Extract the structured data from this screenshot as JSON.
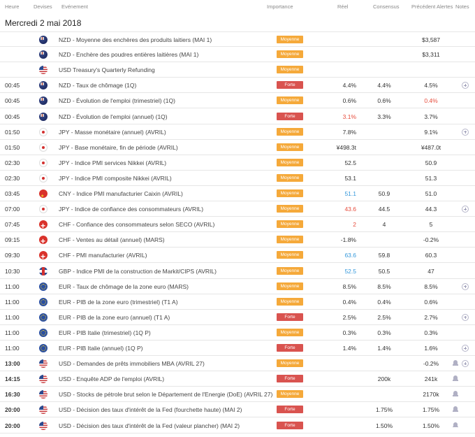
{
  "header": {
    "time": "Heure",
    "currency": "Devises",
    "event": "Evénement",
    "importance": "Importance",
    "actual": "Réel",
    "consensus": "Consensus",
    "previous": "Précédent",
    "alerts": "Alertes",
    "notes": "Notes"
  },
  "date_title": "Mercredi 2 mai 2018",
  "colors": {
    "moyenne": "#f5a93a",
    "forte": "#d9534f",
    "negative_value": "#e74c3c",
    "positive_value": "#3498db"
  },
  "rows": [
    {
      "time": "",
      "bold_time": false,
      "flag": "nz",
      "event": "NZD - Moyenne des enchères des produits laitiers (MAI 1)",
      "importance": "Moyenne",
      "actual": "",
      "actual_color": "",
      "consensus": "",
      "previous": "$3,587",
      "previous_color": "",
      "alert": "",
      "note": ""
    },
    {
      "time": "",
      "bold_time": false,
      "flag": "nz",
      "event": "NZD - Enchère des poudres entières laitières (MAI 1)",
      "importance": "Moyenne",
      "actual": "",
      "actual_color": "",
      "consensus": "",
      "previous": "$3,311",
      "previous_color": "",
      "alert": "",
      "note": ""
    },
    {
      "time": "",
      "bold_time": false,
      "flag": "us",
      "event": "USD Treasury's Quarterly Refunding",
      "importance": "Moyenne",
      "actual": "",
      "actual_color": "",
      "consensus": "",
      "previous": "",
      "previous_color": "",
      "alert": "",
      "note": ""
    },
    {
      "time": "00:45",
      "bold_time": false,
      "flag": "nz",
      "event": "NZD - Taux de chômage (1Q)",
      "importance": "Forte",
      "actual": "4.4%",
      "actual_color": "",
      "consensus": "4.4%",
      "previous": "4.5%",
      "previous_color": "",
      "alert": "",
      "note": "plus-icon"
    },
    {
      "time": "00:45",
      "bold_time": false,
      "flag": "nz",
      "event": "NZD - Évolution de l'emploi (trimestriel) (1Q)",
      "importance": "Moyenne",
      "actual": "0.6%",
      "actual_color": "",
      "consensus": "0.6%",
      "previous": "0.4%",
      "previous_color": "red",
      "alert": "",
      "note": ""
    },
    {
      "time": "00:45",
      "bold_time": false,
      "flag": "nz",
      "event": "NZD - Évolution de l'emploi (annuel) (1Q)",
      "importance": "Forte",
      "actual": "3.1%",
      "actual_color": "red",
      "consensus": "3.3%",
      "previous": "3.7%",
      "previous_color": "",
      "alert": "",
      "note": ""
    },
    {
      "time": "01:50",
      "bold_time": false,
      "flag": "jp",
      "event": "JPY - Masse monétaire (annuel) (AVRIL)",
      "importance": "Moyenne",
      "actual": "7.8%",
      "actual_color": "",
      "consensus": "",
      "previous": "9.1%",
      "previous_color": "",
      "alert": "",
      "note": "plus-icon"
    },
    {
      "time": "01:50",
      "bold_time": false,
      "flag": "jp",
      "event": "JPY - Base monétaire, fin de période (AVRIL)",
      "importance": "Moyenne",
      "actual": "¥498.3t",
      "actual_color": "",
      "consensus": "",
      "previous": "¥487.0t",
      "previous_color": "",
      "alert": "",
      "note": ""
    },
    {
      "time": "02:30",
      "bold_time": false,
      "flag": "jp",
      "event": "JPY - Indice PMI services Nikkei (AVRIL)",
      "importance": "Moyenne",
      "actual": "52.5",
      "actual_color": "",
      "consensus": "",
      "previous": "50.9",
      "previous_color": "",
      "alert": "",
      "note": ""
    },
    {
      "time": "02:30",
      "bold_time": false,
      "flag": "jp",
      "event": "JPY - Indice PMI composite Nikkei (AVRIL)",
      "importance": "Moyenne",
      "actual": "53.1",
      "actual_color": "",
      "consensus": "",
      "previous": "51.3",
      "previous_color": "",
      "alert": "",
      "note": ""
    },
    {
      "time": "03:45",
      "bold_time": false,
      "flag": "cn",
      "event": "CNY - Indice PMI manufacturier Caixin (AVRIL)",
      "importance": "Moyenne",
      "actual": "51.1",
      "actual_color": "blue",
      "consensus": "50.9",
      "previous": "51.0",
      "previous_color": "",
      "alert": "",
      "note": ""
    },
    {
      "time": "07:00",
      "bold_time": false,
      "flag": "jp",
      "event": "JPY - Indice de confiance des consommateurs (AVRIL)",
      "importance": "Moyenne",
      "actual": "43.6",
      "actual_color": "red",
      "consensus": "44.5",
      "previous": "44.3",
      "previous_color": "",
      "alert": "",
      "note": "plus-icon"
    },
    {
      "time": "07:45",
      "bold_time": false,
      "flag": "ch",
      "event": "CHF - Confiance des consommateurs selon SECO (AVRIL)",
      "importance": "Moyenne",
      "actual": "2",
      "actual_color": "red",
      "consensus": "4",
      "previous": "5",
      "previous_color": "",
      "alert": "",
      "note": ""
    },
    {
      "time": "09:15",
      "bold_time": false,
      "flag": "ch",
      "event": "CHF - Ventes au détail (annuel) (MARS)",
      "importance": "Moyenne",
      "actual": "-1.8%",
      "actual_color": "",
      "consensus": "",
      "previous": "-0.2%",
      "previous_color": "",
      "alert": "",
      "note": ""
    },
    {
      "time": "09:30",
      "bold_time": false,
      "flag": "ch",
      "event": "CHF - PMI manufacturier (AVRIL)",
      "importance": "Moyenne",
      "actual": "63.6",
      "actual_color": "blue",
      "consensus": "59.8",
      "previous": "60.3",
      "previous_color": "",
      "alert": "",
      "note": ""
    },
    {
      "time": "10:30",
      "bold_time": false,
      "flag": "gb",
      "event": "GBP - Indice PMI de la construction de Markit/CIPS (AVRIL)",
      "importance": "Moyenne",
      "actual": "52.5",
      "actual_color": "blue",
      "consensus": "50.5",
      "previous": "47",
      "previous_color": "",
      "alert": "",
      "note": ""
    },
    {
      "time": "11:00",
      "bold_time": false,
      "flag": "eu",
      "event": "EUR - Taux de chômage de la zone euro (MARS)",
      "importance": "Moyenne",
      "actual": "8.5%",
      "actual_color": "",
      "consensus": "8.5%",
      "previous": "8.5%",
      "previous_color": "",
      "alert": "",
      "note": "plus-icon"
    },
    {
      "time": "11:00",
      "bold_time": false,
      "flag": "eu",
      "event": "EUR - PIB de la zone euro (trimestriel) (T1 A)",
      "importance": "Moyenne",
      "actual": "0.4%",
      "actual_color": "",
      "consensus": "0.4%",
      "previous": "0.6%",
      "previous_color": "",
      "alert": "",
      "note": ""
    },
    {
      "time": "11:00",
      "bold_time": false,
      "flag": "eu",
      "event": "EUR - PIB de la zone euro (annuel) (T1 A)",
      "importance": "Forte",
      "actual": "2.5%",
      "actual_color": "",
      "consensus": "2.5%",
      "previous": "2.7%",
      "previous_color": "",
      "alert": "",
      "note": "plus-icon"
    },
    {
      "time": "11:00",
      "bold_time": false,
      "flag": "eu",
      "event": "EUR - PIB Italie (trimestriel) (1Q P)",
      "importance": "Moyenne",
      "actual": "0.3%",
      "actual_color": "",
      "consensus": "0.3%",
      "previous": "0.3%",
      "previous_color": "",
      "alert": "",
      "note": ""
    },
    {
      "time": "11:00",
      "bold_time": false,
      "flag": "eu",
      "event": "EUR - PIB Italie (annuel) (1Q P)",
      "importance": "Forte",
      "actual": "1.4%",
      "actual_color": "",
      "consensus": "1.4%",
      "previous": "1.6%",
      "previous_color": "",
      "alert": "",
      "note": "plus-icon"
    },
    {
      "time": "13:00",
      "bold_time": true,
      "flag": "us",
      "event": "USD - Demandes de prêts immobiliers MBA (AVRIL 27)",
      "importance": "Moyenne",
      "actual": "",
      "actual_color": "",
      "consensus": "",
      "previous": "-0.2%",
      "previous_color": "",
      "alert": "bell-icon",
      "note": "plus-icon"
    },
    {
      "time": "14:15",
      "bold_time": true,
      "flag": "us",
      "event": "USD - Enquête ADP de l'emploi (AVRIL)",
      "importance": "Forte",
      "actual": "",
      "actual_color": "",
      "consensus": "200k",
      "previous": "241k",
      "previous_color": "",
      "alert": "bell-icon",
      "note": ""
    },
    {
      "time": "16:30",
      "bold_time": true,
      "flag": "us",
      "event": "USD - Stocks de pétrole brut selon le Département de l'Energie (DoE) (AVRIL 27)",
      "importance": "Moyenne",
      "actual": "",
      "actual_color": "",
      "consensus": "",
      "previous": "2170k",
      "previous_color": "",
      "alert": "bell-icon",
      "note": ""
    },
    {
      "time": "20:00",
      "bold_time": true,
      "flag": "us",
      "event": "USD - Décision des taux d'intérêt de la Fed (fourchette haute) (MAI 2)",
      "importance": "Forte",
      "actual": "",
      "actual_color": "",
      "consensus": "1.75%",
      "previous": "1.75%",
      "previous_color": "",
      "alert": "bell-icon",
      "note": ""
    },
    {
      "time": "20:00",
      "bold_time": true,
      "flag": "us",
      "event": "USD - Décision des taux d'intérêt de la Fed (valeur plancher) (MAI 2)",
      "importance": "Forte",
      "actual": "",
      "actual_color": "",
      "consensus": "1.50%",
      "previous": "1.50%",
      "previous_color": "",
      "alert": "bell-icon",
      "note": ""
    }
  ]
}
